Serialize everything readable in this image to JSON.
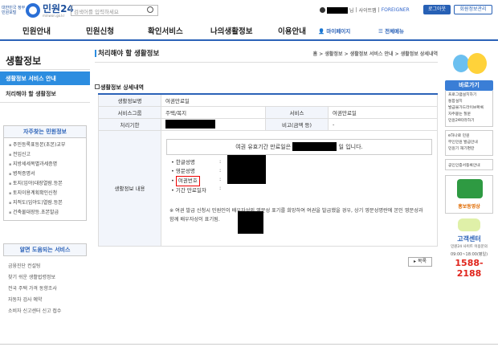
{
  "header": {
    "gov_label": "대한민국 정부민원포털",
    "brand": "민원24",
    "brand_url": "minwon.go.kr",
    "search_placeholder": "검색어를 입력하세요",
    "user_suffix": "님",
    "sitemap": "사이트맵",
    "foreigner": "FOREIGNER",
    "login": "로그아웃",
    "member_info": "회원정보관리"
  },
  "gnb": {
    "items": [
      "민원안내",
      "민원신청",
      "확인서비스",
      "나의생활정보",
      "이용안내"
    ],
    "mypage": "마이페이지",
    "all_menu": "전체메뉴"
  },
  "lnb": {
    "title": "생활정보",
    "active": "생활정보 서비스 안내",
    "sub": "처리해야 할 생활정보",
    "frequent_title": "자주찾는 민원정보",
    "frequent_items": [
      "주민등록표등본(초본)교부",
      "전입신고",
      "지방세세목별과세증명",
      "병적증명서",
      "토지(임야)대장열람.등본",
      "토지이용계획확인신청",
      "지적도(임야도)열람.등본",
      "건축물대장등.초본발급"
    ],
    "useful_title": "알면 도움되는 서비스",
    "useful_items": [
      "금융진단 컨설팅",
      "찾기 쉬운 생활법령정보",
      "전국 주택 가격 동향조사",
      "자동차 검사 예약",
      "소비자 신고센터 신고 접수"
    ]
  },
  "content": {
    "title": "처리해야 할 생활정보",
    "breadcrumb": "홈 > 생활정보 > 생활정보 서비스 안내 > 생활정보 상세내역",
    "section": "생활정보 상세내역",
    "rows": {
      "name_label": "생활정보명",
      "name_value": "여권만료일",
      "group_label": "서비스그룹",
      "group_value": "주택/복지",
      "service_label": "서비스",
      "service_value": "여권만료일",
      "deadline_label": "처리기한",
      "remark_label": "비고(금액 등)",
      "remark_value": "-",
      "detail_label": "생활정보 내용"
    },
    "notice_prefix": "여권 유효기간 만료일은",
    "notice_suffix": "일 입니다.",
    "fields": [
      "한글성명",
      "영문성명",
      "여권번호",
      "기간 만료일자"
    ],
    "note": "※ 여권 발급 신청시 민원인이 배우자성의 영문성 표기를 희망하여 여권을 발급했을 경우, 상기 영문성명란에 본인 영문성과 함께 배우자성이 표기됨.",
    "list_button": "목록"
  },
  "quick": {
    "header": "바로가기",
    "items1": [
      "프로그램설치하기",
      "통합설치",
      "발급물가드라이브확록",
      "자주묻는 질문",
      "민원24따라하기"
    ],
    "items2": [
      "e하나로 민원",
      "무인민원 발급안내",
      "민원기 재기편란"
    ],
    "item3": "공인인증서등록안내",
    "promo": "홍보동영상",
    "cs_title": "고객센터",
    "cs_sub": "민원24 사이트 이용문의",
    "cs_hours": "09:00~18:00(평일)",
    "cs_phone": "1588-2188"
  }
}
